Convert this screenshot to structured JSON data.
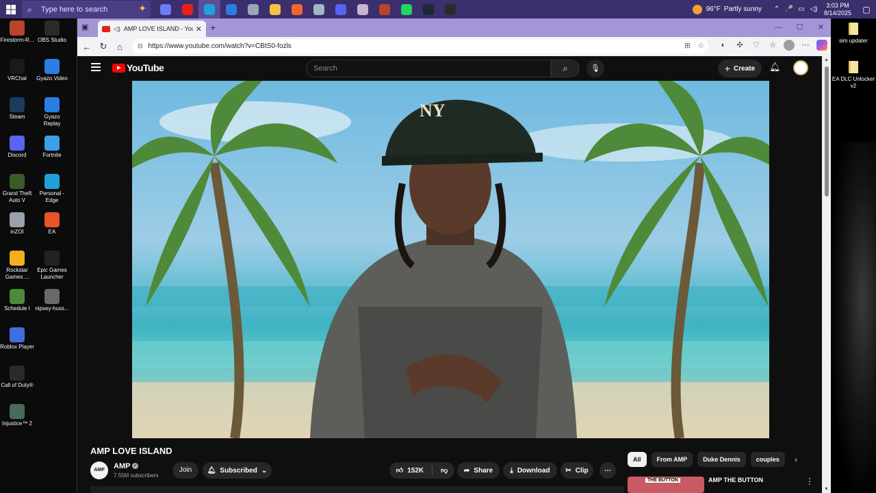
{
  "taskbar": {
    "search_placeholder": "Type here to search",
    "pinned": [
      {
        "name": "copilot-icon",
        "color": "#6f7bf5"
      },
      {
        "name": "youtube-icon",
        "color": "#e62117"
      },
      {
        "name": "edge-icon",
        "color": "#1fa0d8"
      },
      {
        "name": "gyazo-icon",
        "color": "#2a7de1"
      },
      {
        "name": "app-icon",
        "color": "#9aa6b8"
      },
      {
        "name": "file-explorer-icon",
        "color": "#f5c342"
      },
      {
        "name": "firefox-icon",
        "color": "#f0682c"
      },
      {
        "name": "notes-icon",
        "color": "#9fb7c9"
      },
      {
        "name": "discord-icon",
        "color": "#5865f2"
      },
      {
        "name": "game-icon",
        "color": "#c9b4d6"
      },
      {
        "name": "firestorm-icon",
        "color": "#b8442d"
      },
      {
        "name": "spotify-icon",
        "color": "#1ed760"
      },
      {
        "name": "steam-icon",
        "color": "#1b2838"
      },
      {
        "name": "obs-icon",
        "color": "#2b2b2b"
      }
    ],
    "weather": {
      "temp": "96°F",
      "desc": "Partly sunny"
    },
    "clock": {
      "time": "3:03 PM",
      "date": "8/14/2025"
    }
  },
  "desktop_left": [
    {
      "label": "Firestorm-R...",
      "color": "#b8442d"
    },
    {
      "label": "OBS Studio",
      "color": "#2b2b2b"
    },
    {
      "label": "VRChat",
      "color": "#1a1a1a"
    },
    {
      "label": "Gyazo Video",
      "color": "#2a7de1"
    },
    {
      "label": "Steam",
      "color": "#1b3a5c"
    },
    {
      "label": "Gyazo Replay",
      "color": "#2a7de1"
    },
    {
      "label": "Discord",
      "color": "#5865f2"
    },
    {
      "label": "Fortnite",
      "color": "#3aa0e8"
    },
    {
      "label": "Grand Theft Auto V",
      "color": "#3b5a2a"
    },
    {
      "label": "Personal - Edge",
      "color": "#1fa0d8"
    },
    {
      "label": "inZOI",
      "color": "#9aa0ad"
    },
    {
      "label": "EA",
      "color": "#e8542a"
    },
    {
      "label": "Rockstar Games ...",
      "color": "#f2b01e"
    },
    {
      "label": "Epic Games Launcher",
      "color": "#222222"
    },
    {
      "label": "Schedule I",
      "color": "#4d8a3a"
    },
    {
      "label": "nipsey-huss...",
      "color": "#6a6a6a"
    },
    {
      "label": "Roblox Player",
      "color": "#3e6ee0"
    },
    {
      "label": "Call of Duty®",
      "color": "#2a2a2a"
    },
    {
      "label": "Injustice™ 2",
      "color": "#4a6a5a"
    }
  ],
  "desktop_right": [
    {
      "label": "sim updater"
    },
    {
      "label": "EA DLC Unlocker v2"
    }
  ],
  "browser": {
    "tab_title": "AMP LOVE ISLAND - YouTube",
    "url": "https://www.youtube.com/watch?v=CBtS0-fozls"
  },
  "youtube": {
    "logo_text": "YouTube",
    "search_placeholder": "Search",
    "create_label": "Create",
    "video_title": "AMP LOVE ISLAND",
    "channel": {
      "name": "AMP",
      "avatar_text": "AMP",
      "subscribers": "7.55M subscribers"
    },
    "join_label": "Join",
    "subscribed_label": "Subscribed",
    "likes": "152K",
    "share_label": "Share",
    "download_label": "Download",
    "clip_label": "Clip",
    "chips": [
      "All",
      "From AMP",
      "Duke Dennis",
      "couples"
    ],
    "recommended": {
      "title": "AMP THE BUTTON",
      "thumb_tag": "THE BUTTON"
    }
  }
}
